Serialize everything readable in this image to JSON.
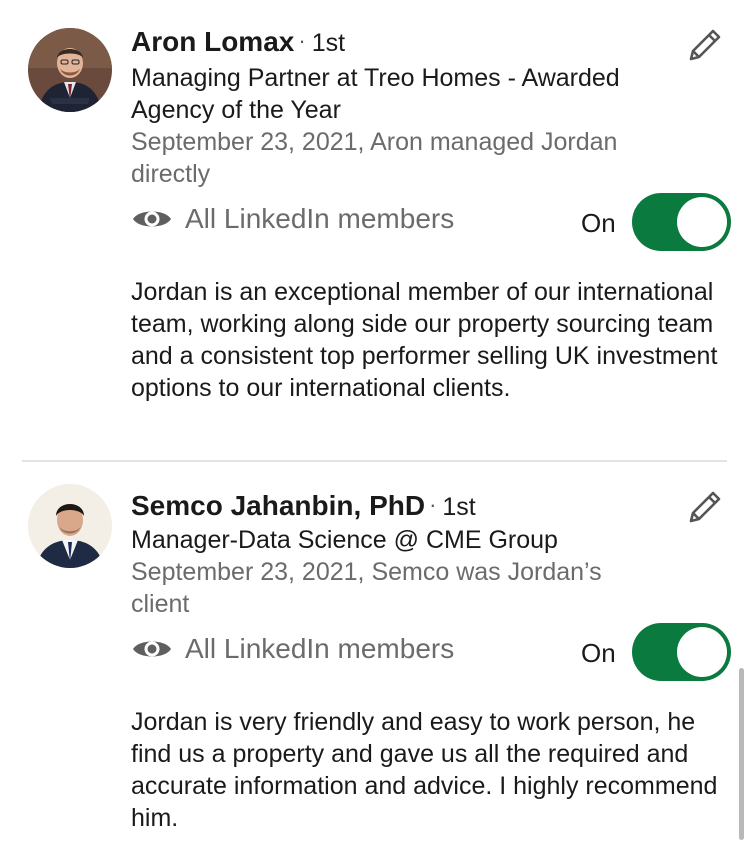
{
  "recommendations": [
    {
      "name": "Aron Lomax",
      "degree": "1st",
      "headline": "Managing Partner at Treo Homes - Awarded Agency of the Year",
      "meta": "September 23, 2021, Aron managed Jordan directly",
      "visibility": "All LinkedIn members",
      "toggle_label": "On",
      "toggle_on": true,
      "text": "Jordan is an exceptional member of our international team, working along side our property sourcing team and a consistent top performer selling UK investment options to our international clients."
    },
    {
      "name": "Semco Jahanbin, PhD",
      "degree": "1st",
      "headline": "Manager-Data Science @ CME Group",
      "meta": "September 23, 2021, Semco was Jordan’s client",
      "visibility": "All LinkedIn members",
      "toggle_label": "On",
      "toggle_on": true,
      "text": "Jordan is very friendly and easy to work person, he find us a property and gave us all the required and accurate information and advice. I highly recommend him."
    }
  ],
  "icons": {
    "edit": "pencil-icon",
    "visibility": "eye-icon"
  },
  "colors": {
    "toggle_on": "#0a7a3f",
    "secondary_text": "#6b6b6b"
  }
}
